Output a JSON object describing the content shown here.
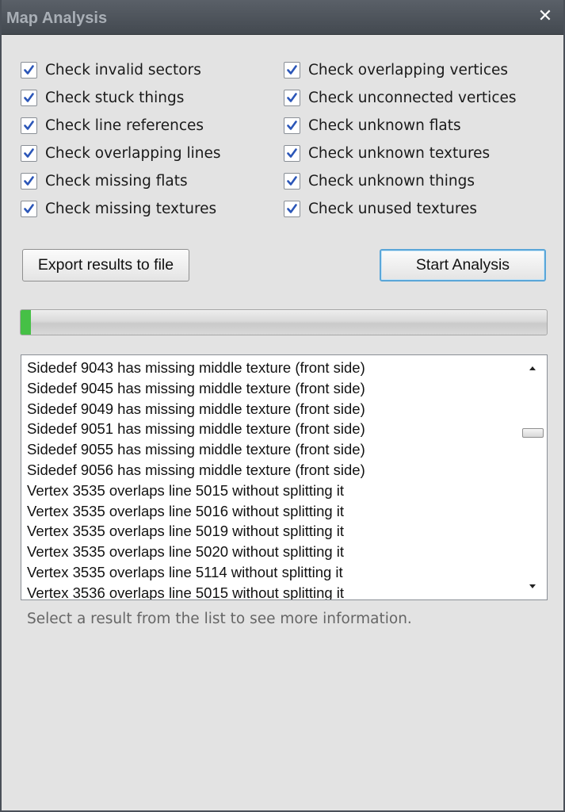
{
  "window": {
    "title": "Map Analysis",
    "close_glyph": "✕"
  },
  "checks_left": [
    {
      "label": "Check invalid sectors",
      "checked": true
    },
    {
      "label": "Check stuck things",
      "checked": true
    },
    {
      "label": "Check line references",
      "checked": true
    },
    {
      "label": "Check overlapping lines",
      "checked": true
    },
    {
      "label": "Check missing flats",
      "checked": true
    },
    {
      "label": "Check missing textures",
      "checked": true
    }
  ],
  "checks_right": [
    {
      "label": "Check overlapping vertices",
      "checked": true
    },
    {
      "label": "Check unconnected vertices",
      "checked": true
    },
    {
      "label": "Check unknown flats",
      "checked": true
    },
    {
      "label": "Check unknown textures",
      "checked": true
    },
    {
      "label": "Check unknown things",
      "checked": true
    },
    {
      "label": "Check unused textures",
      "checked": true
    }
  ],
  "buttons": {
    "export_label": "Export results to file",
    "start_label": "Start Analysis"
  },
  "progress": {
    "value": 0.003,
    "fill_color": "#46c046"
  },
  "results": [
    "Sidedef 9043 has missing middle texture (front side)",
    "Sidedef 9045 has missing middle texture (front side)",
    "Sidedef 9049 has missing middle texture (front side)",
    "Sidedef 9051 has missing middle texture (front side)",
    "Sidedef 9055 has missing middle texture (front side)",
    "Sidedef 9056 has missing middle texture (front side)",
    "Vertex 3535 overlaps line 5015 without splitting it",
    "Vertex 3535 overlaps line 5016 without splitting it",
    "Vertex 3535 overlaps line 5019 without splitting it",
    "Vertex 3535 overlaps line 5020 without splitting it",
    "Vertex 3535 overlaps line 5114 without splitting it",
    "Vertex 3536 overlaps line 5015 without splitting it"
  ],
  "info_text": "Select a result from the list to see more information.",
  "icons": {
    "checkbox": "checkmark-icon",
    "scroll_up": "scroll-up-arrow-icon",
    "scroll_down": "scroll-down-arrow-icon",
    "close": "close-icon"
  },
  "colors": {
    "titlebar": "#4d535a",
    "title_text": "#a9afb6",
    "checkmark": "#2b56b8",
    "default_button_border": "#5aa6d8",
    "info_text": "#666666"
  }
}
